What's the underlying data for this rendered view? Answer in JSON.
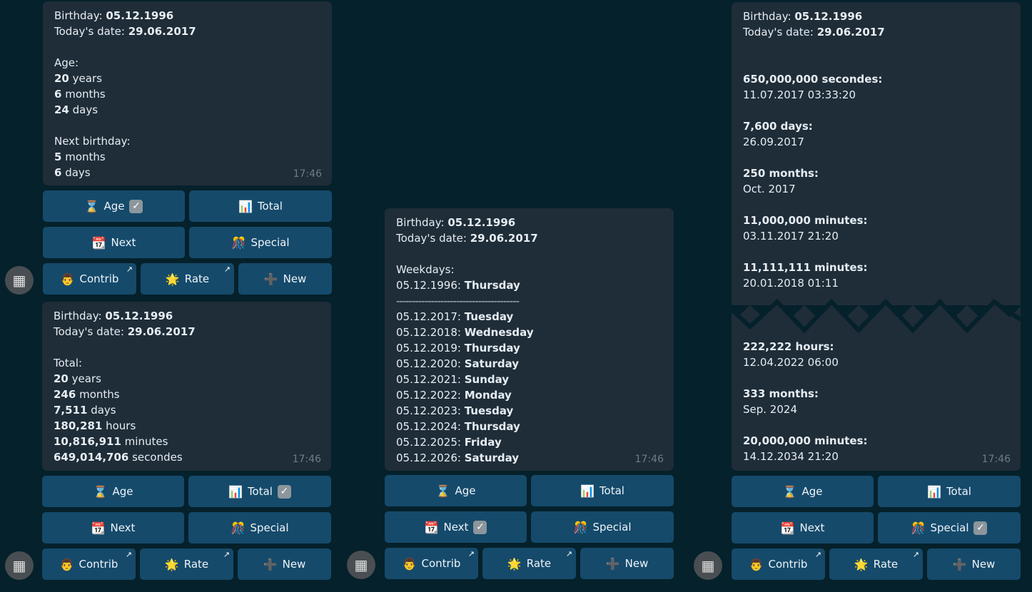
{
  "time": "17:46",
  "labels": {
    "birthday": "Birthday: ",
    "today": "Today's date: ",
    "age": "Age:",
    "total": "Total:",
    "next_birthday": "Next birthday:",
    "weekdays": "Weekdays:",
    "separator": "---------------------------------------"
  },
  "values": {
    "birthday": "05.12.1996",
    "today": "29.06.2017"
  },
  "age": [
    {
      "num": "20",
      "unit": " years"
    },
    {
      "num": "6",
      "unit": " months"
    },
    {
      "num": "24",
      "unit": " days"
    }
  ],
  "next_birthday": [
    {
      "num": "5",
      "unit": " months"
    },
    {
      "num": "6",
      "unit": " days"
    }
  ],
  "total": [
    {
      "num": "20",
      "unit": " years"
    },
    {
      "num": "246",
      "unit": " months"
    },
    {
      "num": "7,511",
      "unit": " days"
    },
    {
      "num": "180,281",
      "unit": " hours"
    },
    {
      "num": "10,816,911",
      "unit": " minutes"
    },
    {
      "num": "649,014,706",
      "unit": " secondes"
    }
  ],
  "weekdays": {
    "birth": {
      "date": "05.12.1996: ",
      "day": "Thursday"
    },
    "future": [
      {
        "date": "05.12.2017: ",
        "day": "Tuesday"
      },
      {
        "date": "05.12.2018: ",
        "day": "Wednesday"
      },
      {
        "date": "05.12.2019: ",
        "day": "Thursday"
      },
      {
        "date": "05.12.2020: ",
        "day": "Saturday"
      },
      {
        "date": "05.12.2021: ",
        "day": "Sunday"
      },
      {
        "date": "05.12.2022: ",
        "day": "Monday"
      },
      {
        "date": "05.12.2023: ",
        "day": "Tuesday"
      },
      {
        "date": "05.12.2024: ",
        "day": "Thursday"
      },
      {
        "date": "05.12.2025: ",
        "day": "Friday"
      },
      {
        "date": "05.12.2026: ",
        "day": "Saturday"
      }
    ]
  },
  "special_top": [
    {
      "label": "650,000,000 secondes:",
      "value": "11.07.2017 03:33:20"
    },
    {
      "label": "7,600 days:",
      "value": "26.09.2017"
    },
    {
      "label": "250 months:",
      "value": "Oct. 2017"
    },
    {
      "label": "11,000,000 minutes:",
      "value": "03.11.2017 21:20"
    },
    {
      "label": "11,111,111 minutes:",
      "value": "20.01.2018 01:11"
    }
  ],
  "special_bottom": [
    {
      "label": "222,222 hours:",
      "value": "12.04.2022 06:00"
    },
    {
      "label": "333 months:",
      "value": "Sep. 2024"
    },
    {
      "label": "20,000,000 minutes:",
      "value": "14.12.2034 21:20"
    }
  ],
  "buttons": {
    "age": "Age",
    "total": "Total",
    "next": "Next",
    "special": "Special",
    "contrib": "Contrib",
    "rate": "Rate",
    "new": "New"
  },
  "icons": {
    "age": "hourglass-icon",
    "total": "bar-chart-icon",
    "next": "calendar-icon",
    "special": "confetti-icon",
    "contrib": "person-icon",
    "rate": "star-icon",
    "new": "plus-icon",
    "external": "arrow-up-right-icon",
    "checked": "check-box-icon",
    "bot": "calculator-icon"
  },
  "colors": {
    "background": "#05212b",
    "bubble": "#1f2d38",
    "button": "#154a6b",
    "timestamp": "#6b7c89"
  }
}
